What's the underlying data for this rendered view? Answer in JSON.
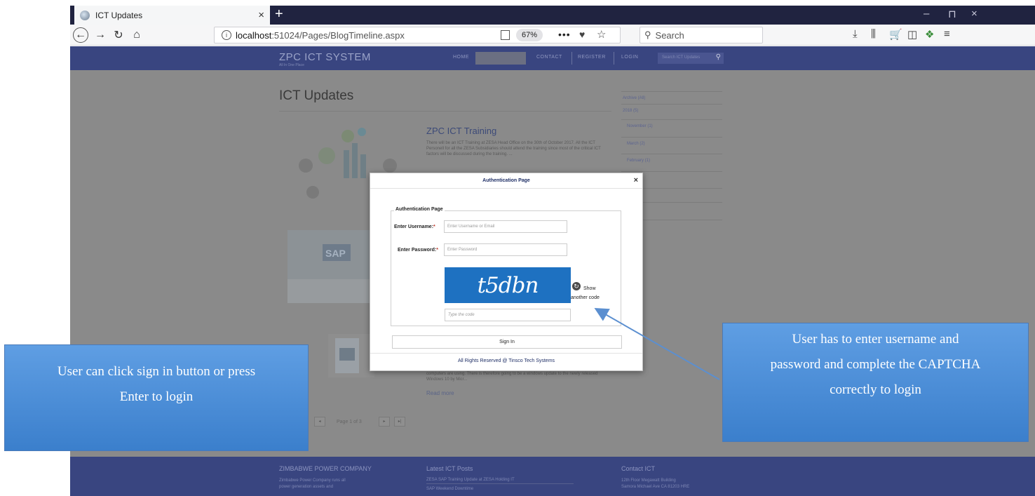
{
  "browser": {
    "tab_title": "ICT Updates",
    "tab_close": "×",
    "new_tab": "+",
    "url_host": "localhost",
    "url_path": ":51024/Pages/BlogTimeline.aspx",
    "zoom": "67%",
    "search_placeholder": "Search",
    "window_controls": [
      "–",
      "⊓",
      "×"
    ]
  },
  "site": {
    "brand": "ZPC ICT SYSTEM",
    "brand_sub": "All In One Place",
    "menu": [
      "HOME",
      "CONTACT",
      "REGISTER",
      "LOGIN"
    ],
    "search_placeholder": "Search ICT Updates",
    "page_title": "ICT Updates",
    "post1_title": "ZPC ICT Training",
    "post1_text": "There will be an ICT Training at ZESA Head Office on the 30th of October 2017. All the ICT Personell for all the ZESA Subsidiaries should attend the training since most of the critical ICT factors will be discussed during the training. ...",
    "post3_text": "computers are using. There is therefore going to be a windows update to the newly released Windows 10 by Micr...",
    "read_more": "Read more",
    "pager": "Page 1 of 3",
    "archive": [
      "Archive (All)",
      "2018 (5)",
      "November (1)",
      "March (2)",
      "February (1)",
      "ry (1)",
      "",
      "mber (2)",
      "ber (1)"
    ],
    "thumb_label": "SAP",
    "footer": {
      "col1_head": "ZIMBABWE POWER COMPANY",
      "col1_lines": [
        "Zimbabwe Power Company runs all",
        "power generation assets and"
      ],
      "col2_head": "Latest ICT Posts",
      "col2_lines": [
        "ZESA SAP Training Update at ZESA Holding IT",
        "SAP Weekend Downtime"
      ],
      "col3_head": "Contact ICT",
      "col3_lines": [
        "12th Floor Megawatt Building",
        "Samora Michael Ave CA 81203 HRE"
      ]
    }
  },
  "modal": {
    "title": "Authentication Page",
    "close": "×",
    "legend": "Authentication Page",
    "username_label": "Enter Username:",
    "username_placeholder": "Enter Username or Email",
    "password_label": "Enter Password:",
    "password_placeholder": "Enter Password",
    "captcha_text": "t5dbn",
    "refresh_line1": "Show",
    "refresh_line2": "another code",
    "code_placeholder": "Type the code",
    "signin_label": "Sign In",
    "footer": "All Rights Reserved @ Tinsco Tech Systems",
    "required_mark": "*"
  },
  "callouts": {
    "left": [
      "User can click sign in button or press",
      "Enter to login"
    ],
    "right": [
      "User has to enter username and",
      "password and complete the CAPTCHA",
      "correctly to login"
    ]
  },
  "colors": {
    "header": "#394580",
    "captcha": "#1e71c1",
    "callout": "#4a8ad6"
  }
}
